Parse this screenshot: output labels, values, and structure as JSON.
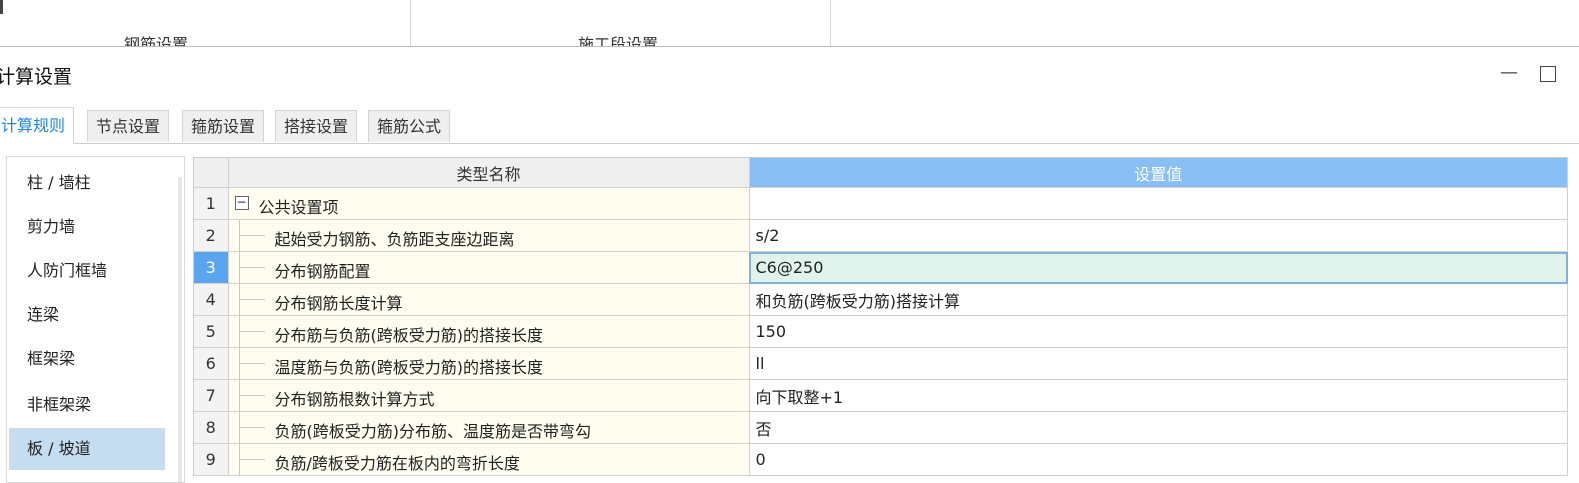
{
  "top_bar": {
    "left_label": "钢筋设置",
    "right_label": "施工段设置"
  },
  "window": {
    "title": "计算设置"
  },
  "tabs": [
    {
      "label": "计算规则",
      "active": true
    },
    {
      "label": "节点设置"
    },
    {
      "label": "箍筋设置"
    },
    {
      "label": "搭接设置"
    },
    {
      "label": "箍筋公式"
    }
  ],
  "side_list": [
    {
      "label": "柱 / 墙柱"
    },
    {
      "label": "剪力墙"
    },
    {
      "label": "人防门框墙"
    },
    {
      "label": "连梁"
    },
    {
      "label": "框架梁"
    },
    {
      "label": "非框架梁"
    },
    {
      "label": "板 / 坡道",
      "selected": true
    }
  ],
  "grid": {
    "columns": {
      "name": "类型名称",
      "value": "设置值"
    },
    "rows": [
      {
        "num": "1",
        "name": "公共设置项",
        "value": "",
        "group": true,
        "expander": "−"
      },
      {
        "num": "2",
        "name": "起始受力钢筋、负筋距支座边距离",
        "value": "s/2"
      },
      {
        "num": "3",
        "name": "分布钢筋配置",
        "value": "C6@250",
        "current": true
      },
      {
        "num": "4",
        "name": "分布钢筋长度计算",
        "value": "和负筋(跨板受力筋)搭接计算"
      },
      {
        "num": "5",
        "name": "分布筋与负筋(跨板受力筋)的搭接长度",
        "value": "150"
      },
      {
        "num": "6",
        "name": "温度筋与负筋(跨板受力筋)的搭接长度",
        "value": "ll"
      },
      {
        "num": "7",
        "name": "分布钢筋根数计算方式",
        "value": "向下取整+1"
      },
      {
        "num": "8",
        "name": "负筋(跨板受力筋)分布筋、温度筋是否带弯勾",
        "value": "否"
      },
      {
        "num": "9",
        "name": "负筋/跨板受力筋在板内的弯折长度",
        "value": "0"
      }
    ]
  }
}
